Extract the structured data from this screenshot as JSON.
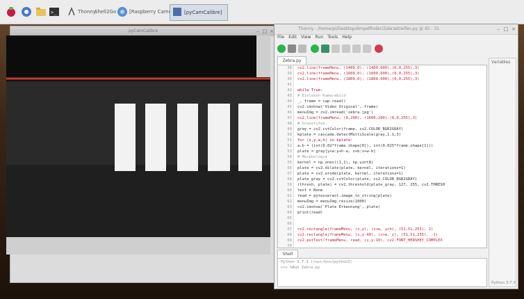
{
  "taskbar": {
    "items": [
      {
        "label": "Thonny",
        "icon": "thonny-icon"
      },
      {
        "label": "Shell2Go",
        "icon": "terminal-icon"
      },
      {
        "label": "[Raspberry Camera]",
        "icon": "camera-icon"
      },
      {
        "label": "[pyCamCalibre]",
        "icon": "window-icon"
      }
    ]
  },
  "camera_window": {
    "title": "pyCamCalibre"
  },
  "ide": {
    "title": "Thonny - /home/pi/Desktop/Ampelfinder/Zebrastreifen.py @ 45 : 31",
    "menu": [
      "File",
      "Edit",
      "View",
      "Run",
      "Tools",
      "Help"
    ],
    "tab": "Zebra.py",
    "shell_tab": "Shell",
    "shell_lines": [
      "Python 3.7.3 (/usr/bin/python3)",
      ">>> %Run Zebra.py"
    ],
    "right_pane_title": "Variables",
    "right_pane_footer": "Python 3.7.3",
    "code": [
      {
        "n": "38",
        "t": "    cv2.line(frameMenu, (1400,0), (1400,600),(0,0,255),3)",
        "c": "#b23"
      },
      {
        "n": "39",
        "t": "    cv2.line(frameMenu, (1600,0), (1600,600),(0,0,255),3)",
        "c": "#b23"
      },
      {
        "n": "40",
        "t": "    cv2.line(frameMenu, (1800,0), (1800,600),(0,0,255),3)",
        "c": "#b23"
      },
      {
        "n": "41",
        "t": "",
        "c": "#333"
      },
      {
        "n": "42",
        "t": "while True:",
        "c": "#a05"
      },
      {
        "n": "43",
        "t": "    # Einlesen Kamerabild",
        "c": "#999"
      },
      {
        "n": "44",
        "t": "    _, frame = cap.read()",
        "c": "#333"
      },
      {
        "n": "45",
        "t": "    cv2.imshow('Video Original', frame)",
        "c": "#333"
      },
      {
        "n": "46",
        "t": "    menuImg = cv2.imread('zebra.jpg')",
        "c": "#333"
      },
      {
        "n": "47",
        "t": "    cv2.line(frameMenu, (0,200), (1600,200),(0,0,255),3)",
        "c": "#b23"
      },
      {
        "n": "48",
        "t": "    # Graustufen",
        "c": "#999"
      },
      {
        "n": "49",
        "t": "    gray = cv2.cvtColor(frame, cv2.COLOR_BGR2GRAY)",
        "c": "#333"
      },
      {
        "n": "50",
        "t": "    kplate = cascade.detectMultiScale(gray,1.1,3)",
        "c": "#333"
      },
      {
        "n": "51",
        "t": "    for (x,y,w,h) in kplate:",
        "c": "#a05"
      },
      {
        "n": "52",
        "t": "        a,b = (int(0.02*frame.shape[0]), int(0.025*frame.shape[1]))",
        "c": "#333"
      },
      {
        "n": "53",
        "t": "        plate = gray[y+a:y+h-a, x+b:x+w-b]",
        "c": "#333"
      },
      {
        "n": "54",
        "t": "        # Morphologie",
        "c": "#999"
      },
      {
        "n": "55",
        "t": "        kernel = np.ones((1,1), np.uint8)",
        "c": "#333"
      },
      {
        "n": "56",
        "t": "        plate = cv2.dilate(plate, kernel, iterations=1)",
        "c": "#333"
      },
      {
        "n": "57",
        "t": "        plate = cv2.erode(plate, kernel, iterations=1)",
        "c": "#333"
      },
      {
        "n": "58",
        "t": "        plate_gray = cv2.cvtColor(plate, cv2.COLOR_BGR2GRAY)",
        "c": "#333"
      },
      {
        "n": "59",
        "t": "        (thresh, plate) = cv2.threshold(plate_gray, 127, 255, cv2.THRESH",
        "c": "#333"
      },
      {
        "n": "60",
        "t": "        text = None",
        "c": "#333"
      },
      {
        "n": "61",
        "t": "        read = pytesseract.image_to_string(plate)",
        "c": "#333"
      },
      {
        "n": "62",
        "t": "        menuImg = menuImg.resize(1000)",
        "c": "#333"
      },
      {
        "n": "63",
        "t": "        cv2.imshow('Plate Erkennung', plate)",
        "c": "#333"
      },
      {
        "n": "64",
        "t": "        print(read)",
        "c": "#333"
      },
      {
        "n": "65",
        "t": "",
        "c": "#333"
      },
      {
        "n": "66",
        "t": "",
        "c": "#333"
      },
      {
        "n": "67",
        "t": "        cv2.rectangle(frameMenu, (x,y), (x+w, y+h), (51,51,255), 2)",
        "c": "#b23"
      },
      {
        "n": "68",
        "t": "        cv2.rectangle(frameMenu, (x,y-40), (x+w, y), (51,51,255), -1)",
        "c": "#b23"
      },
      {
        "n": "69",
        "t": "        cv2.putText(frameMenu, read, (x,y-10), cv2.FONT_HERSHEY_COMPLEX",
        "c": "#b23"
      },
      {
        "n": "70",
        "t": "",
        "c": "#333"
      }
    ]
  },
  "colors": {
    "accent": "#3b6ea8",
    "run_green": "#2bb24c",
    "stop_red": "#d23b4f"
  }
}
